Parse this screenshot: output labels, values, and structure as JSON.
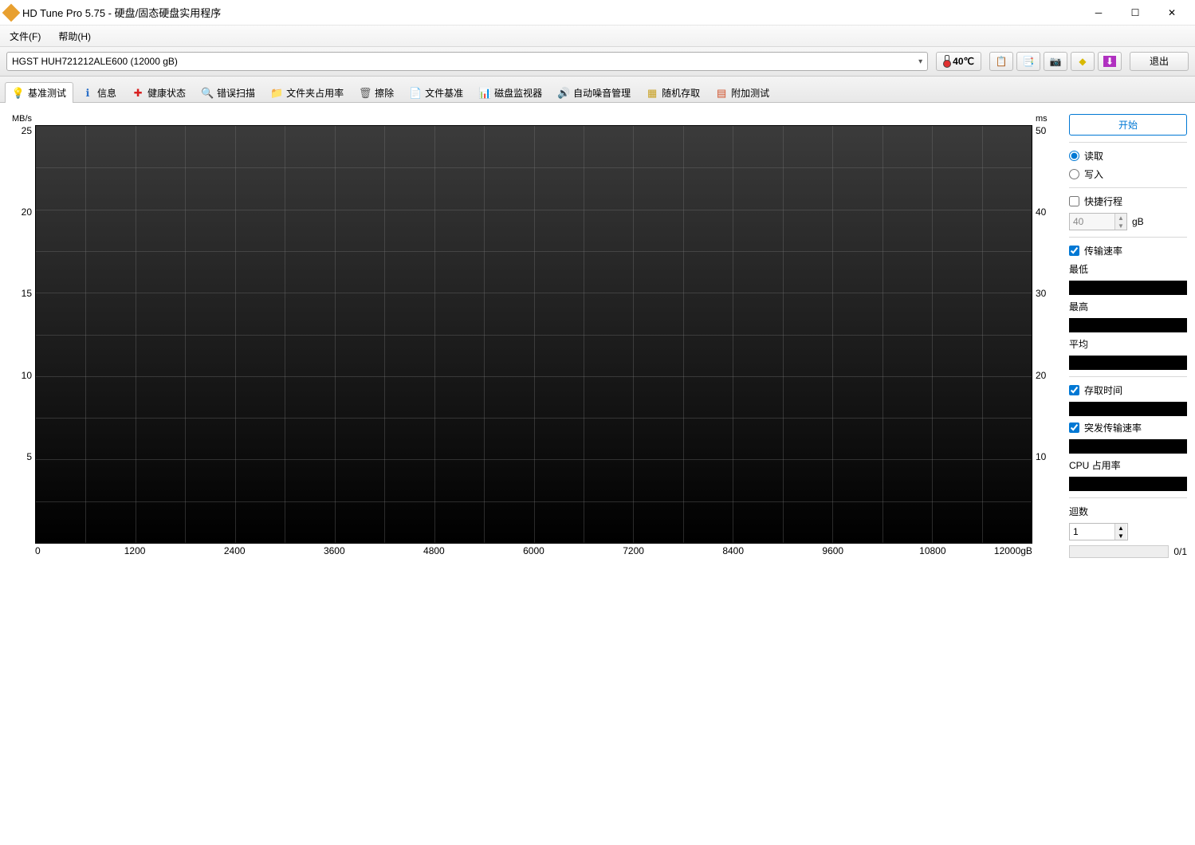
{
  "window": {
    "title": "HD Tune Pro 5.75 - 硬盘/固态硬盘实用程序"
  },
  "menu": {
    "file": "文件(F)",
    "help": "帮助(H)"
  },
  "toolbar": {
    "drive": "HGST HUH721212ALE600 (12000 gB)",
    "temp": "40℃",
    "exit": "退出"
  },
  "tabs": [
    {
      "id": "benchmark",
      "label": "基准测试",
      "icon": "bulb",
      "glyph": "💡",
      "active": true
    },
    {
      "id": "info",
      "label": "信息",
      "icon": "info",
      "glyph": "ℹ"
    },
    {
      "id": "health",
      "label": "健康状态",
      "icon": "plus",
      "glyph": "✚"
    },
    {
      "id": "errscan",
      "label": "错误扫描",
      "icon": "mag",
      "glyph": "🔍"
    },
    {
      "id": "folder",
      "label": "文件夹占用率",
      "icon": "fold",
      "glyph": "📁"
    },
    {
      "id": "erase",
      "label": "擦除",
      "icon": "trash",
      "glyph": "🗑"
    },
    {
      "id": "filebench",
      "label": "文件基准",
      "icon": "file",
      "glyph": "📄"
    },
    {
      "id": "diskmon",
      "label": "磁盘监视器",
      "icon": "bars",
      "glyph": "📊"
    },
    {
      "id": "aam",
      "label": "自动噪音管理",
      "icon": "sound",
      "glyph": "🔊"
    },
    {
      "id": "random",
      "label": "随机存取",
      "icon": "rand",
      "glyph": "▦"
    },
    {
      "id": "extra",
      "label": "附加测试",
      "icon": "extra",
      "glyph": "▤"
    }
  ],
  "panel": {
    "start": "开始",
    "read": "读取",
    "write": "写入",
    "shortstroke": "快捷行程",
    "shortstroke_val": "40",
    "gb_unit": "gB",
    "transfer_rate": "传输速率",
    "min": "最低",
    "max": "最高",
    "avg": "平均",
    "access_time": "存取时间",
    "burst_rate": "突发传输速率",
    "cpu_usage": "CPU 占用率",
    "loops": "迴数",
    "loops_val": "1",
    "progress": "0/1"
  },
  "chart_data": {
    "type": "line",
    "title": "",
    "xlabel": "gB",
    "ylabel_left": "MB/s",
    "ylabel_right": "ms",
    "x_ticks": [
      0,
      1200,
      2400,
      3600,
      4800,
      6000,
      7200,
      8400,
      9600,
      10800,
      12000
    ],
    "y_left_ticks": [
      5,
      10,
      15,
      20,
      25
    ],
    "y_right_ticks": [
      10,
      20,
      30,
      40,
      50
    ],
    "xlim": [
      0,
      12000
    ],
    "ylim_left": [
      0,
      25
    ],
    "ylim_right": [
      0,
      50
    ],
    "series": []
  }
}
